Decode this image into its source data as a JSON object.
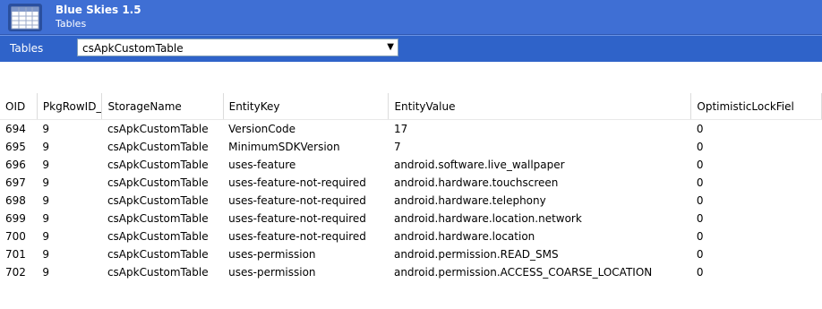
{
  "app": {
    "title": "Blue Skies 1.5",
    "subtitle": "Tables"
  },
  "toolbar": {
    "tables_label": "Tables",
    "selected_table": "csApkCustomTable",
    "dropdown_arrow": "▼"
  },
  "grid": {
    "columns": [
      "OID",
      "PkgRowID_",
      "StorageName",
      "EntityKey",
      "EntityValue",
      "OptimisticLockFiel"
    ],
    "rows": [
      [
        "694",
        "9",
        "csApkCustomTable",
        "VersionCode",
        "17",
        "0"
      ],
      [
        "695",
        "9",
        "csApkCustomTable",
        "MinimumSDKVersion",
        "7",
        "0"
      ],
      [
        "696",
        "9",
        "csApkCustomTable",
        "uses-feature",
        "android.software.live_wallpaper",
        "0"
      ],
      [
        "697",
        "9",
        "csApkCustomTable",
        "uses-feature-not-required",
        "android.hardware.touchscreen",
        "0"
      ],
      [
        "698",
        "9",
        "csApkCustomTable",
        "uses-feature-not-required",
        "android.hardware.telephony",
        "0"
      ],
      [
        "699",
        "9",
        "csApkCustomTable",
        "uses-feature-not-required",
        "android.hardware.location.network",
        "0"
      ],
      [
        "700",
        "9",
        "csApkCustomTable",
        "uses-feature-not-required",
        "android.hardware.location",
        "0"
      ],
      [
        "701",
        "9",
        "csApkCustomTable",
        "uses-permission",
        "android.permission.READ_SMS",
        "0"
      ],
      [
        "702",
        "9",
        "csApkCustomTable",
        "uses-permission",
        "android.permission.ACCESS_COARSE_LOCATION",
        "0"
      ]
    ]
  },
  "colors": {
    "titlebar": "#3f6fd4",
    "toolbar": "#2f63c9"
  },
  "icons": {
    "app": "table-grid-icon",
    "dropdown": "chevron-down-icon"
  }
}
